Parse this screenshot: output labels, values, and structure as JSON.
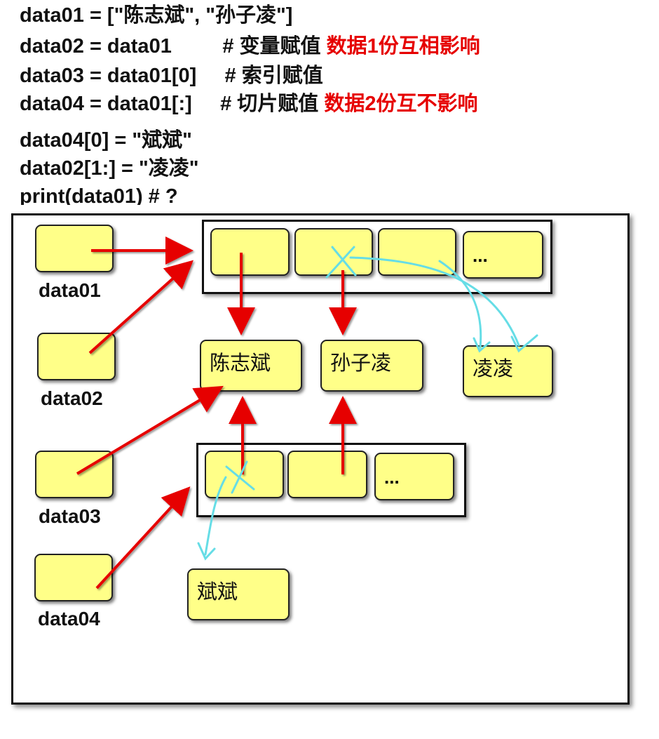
{
  "code": {
    "line1": "data01 = [\"陈志斌\", \"孙子凌\"]",
    "line2_code": "data02 = data01         # 变量赋值 ",
    "line2_note": "数据1份互相影响",
    "line3": "data03 = data01[0]     # 索引赋值",
    "line4_code": "data04 = data01[:]     # 切片赋值 ",
    "line4_note": "数据2份互不影响",
    "line5": "data04[0] = \"斌斌\"",
    "line6": "data02[1:] = \"凌凌\"",
    "line7": "print(data01) # ?"
  },
  "diagram": {
    "vars": [
      "data01",
      "data02",
      "data03",
      "data04"
    ],
    "values": {
      "chen": "陈志斌",
      "sun": "孙子凌",
      "lingling": "凌凌",
      "binbin": "斌斌"
    },
    "ellipsis": "..."
  },
  "colors": {
    "cell_fill": "#ffff88",
    "arrow_red": "#e60000",
    "arrow_cyan": "#66dde6",
    "note_red": "#e60000"
  }
}
